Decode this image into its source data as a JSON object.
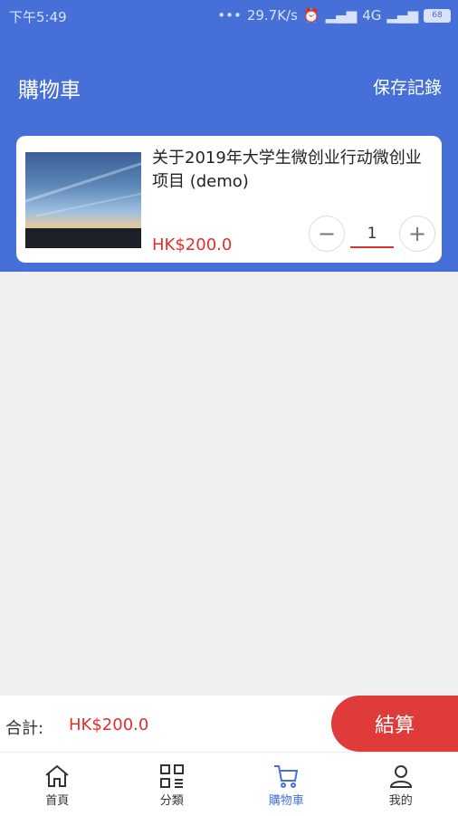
{
  "status_bar": {
    "time": "下午5:49",
    "network": "29.7K/s",
    "signal": "4G",
    "battery": "68"
  },
  "header": {
    "title": "購物車",
    "save_records": "保存記錄"
  },
  "cart_item": {
    "title": "关于2019年大学生微创业行动微创业项目 (demo)",
    "price": "HK$200.0",
    "quantity": "1",
    "minus": "−",
    "plus": "+"
  },
  "total": {
    "label": "合計:",
    "value": "HK$200.0",
    "checkout": "結算"
  },
  "tabs": [
    {
      "label": "首頁",
      "icon": "home-icon"
    },
    {
      "label": "分類",
      "icon": "grid-list-icon"
    },
    {
      "label": "購物車",
      "icon": "cart-icon"
    },
    {
      "label": "我的",
      "icon": "user-icon"
    }
  ],
  "colors": {
    "primary": "#4670d8",
    "accent_red": "#e0302b",
    "checkout": "#df3b3b"
  }
}
